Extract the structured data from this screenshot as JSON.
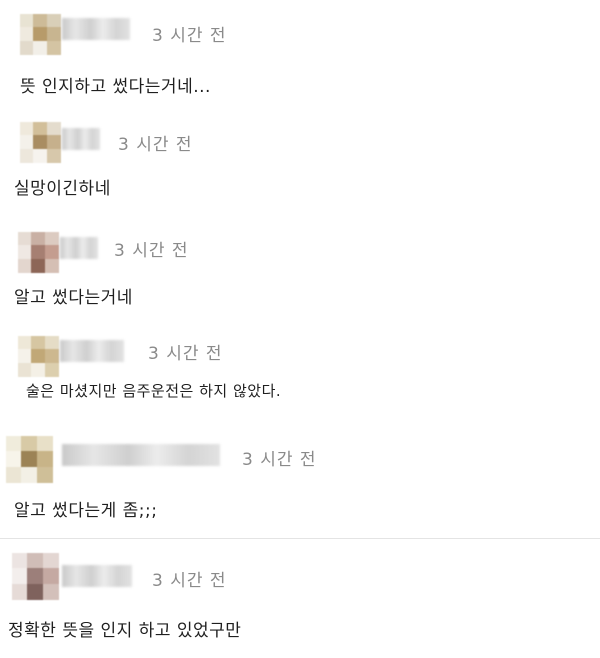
{
  "comments": [
    {
      "time": "3 시간 전",
      "text": "뜻 인지하고 썼다는거네..."
    },
    {
      "time": "3 시간 전",
      "text": "실망이긴하네"
    },
    {
      "time": "3 시간 전",
      "text": "알고 썼다는거네"
    },
    {
      "time": "3 시간 전",
      "text": "술은 마셨지만 음주운전은 하지 않았다."
    },
    {
      "time": "3 시간 전",
      "text": "알고 썼다는게 좀;;;"
    },
    {
      "time": "3 시간 전",
      "text": "정확한 뜻을 인지 하고 있었구만"
    }
  ],
  "avatar_colors": {
    "c1": [
      "#e8e3d3",
      "#cdbb98",
      "#d9cfb8",
      "#efeadf",
      "#b79b6a",
      "#c8b590",
      "#e2dacb",
      "#f2efe8",
      "#d4c4a3"
    ],
    "c2": [
      "#efe9dc",
      "#d2bf9a",
      "#e4dccd",
      "#f4f1ea",
      "#a98d62",
      "#c6b08c",
      "#ede7dc",
      "#f6f3ee",
      "#d7c8ab"
    ],
    "c3": [
      "#e6dcd4",
      "#c9b0a4",
      "#dccbc1",
      "#efe8e3",
      "#a67f72",
      "#c49d8f",
      "#e3d6ce",
      "#8d6657",
      "#d5bfb4"
    ],
    "c4": [
      "#eee8d8",
      "#d6c6a2",
      "#e5dcc6",
      "#f5f2ea",
      "#c1a877",
      "#cdb88f",
      "#eae3d4",
      "#f4f0e6",
      "#dccfae"
    ],
    "c5": [
      "#f0ecdc",
      "#d8caa6",
      "#e8e0c8",
      "#f7f4ea",
      "#9c8356",
      "#c8b488",
      "#ebe5d4",
      "#f3f0e6",
      "#cfbf98"
    ],
    "c6": [
      "#ece4e2",
      "#d0bdb7",
      "#e3d6d2",
      "#f3eeec",
      "#9c7f7a",
      "#c5a9a2",
      "#e6dbd7",
      "#7f625d",
      "#d3c0ba"
    ]
  }
}
